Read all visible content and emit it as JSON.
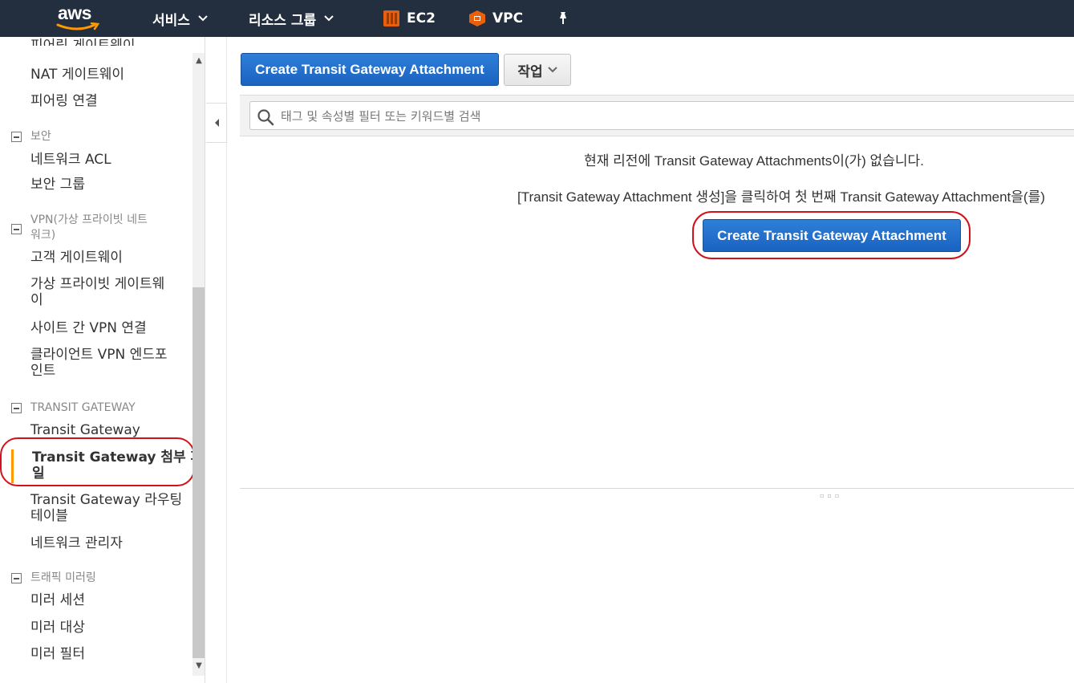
{
  "nav": {
    "logo": "aws",
    "services": "서비스",
    "resource_groups": "리소스 그룹",
    "ec2": "EC2",
    "vpc": "VPC",
    "colors": {
      "bg": "#232f3e",
      "ec2": "#e8600b",
      "vpc": "#e8600b",
      "smile": "#ff9900"
    }
  },
  "sidebar": {
    "partial_top": "피어링 게이트웨이",
    "items_top": [
      "NAT 게이트웨이",
      "피어링 연결"
    ],
    "sections": [
      {
        "title": "보안",
        "items": [
          "네트워크 ACL",
          "보안 그룹"
        ]
      },
      {
        "title_line1": "VPN(가상 프라이빗 네트",
        "title_line2": "워크)",
        "items": [
          "고객 게이트웨이",
          "가상 프라이빗 게이트웨",
          "이",
          "사이트 간 VPN 연결",
          "클라이언트 VPN 엔드포",
          "인트"
        ]
      },
      {
        "title": "TRANSIT GATEWAY",
        "items": [
          "Transit Gateway",
          "Transit Gateway 첨부 파",
          "일",
          "Transit Gateway 라우팅",
          "테이블",
          "네트워크 관리자"
        ]
      },
      {
        "title": "트래픽 미러링",
        "items": [
          "미러 세션",
          "미러 대상",
          "미러 필터"
        ]
      }
    ]
  },
  "main": {
    "create_button": "Create Transit Gateway Attachment",
    "actions_button": "작업",
    "search_placeholder": "태그 및 속성별 필터 또는 키워드별 검색",
    "empty_message": "현재 리전에 Transit Gateway Attachments이(가) 없습니다.",
    "empty_hint": "[Transit Gateway Attachment 생성]을 클릭하여 첫 번째 Transit Gateway Attachment을(를)",
    "center_button": "Create Transit Gateway Attachment"
  }
}
